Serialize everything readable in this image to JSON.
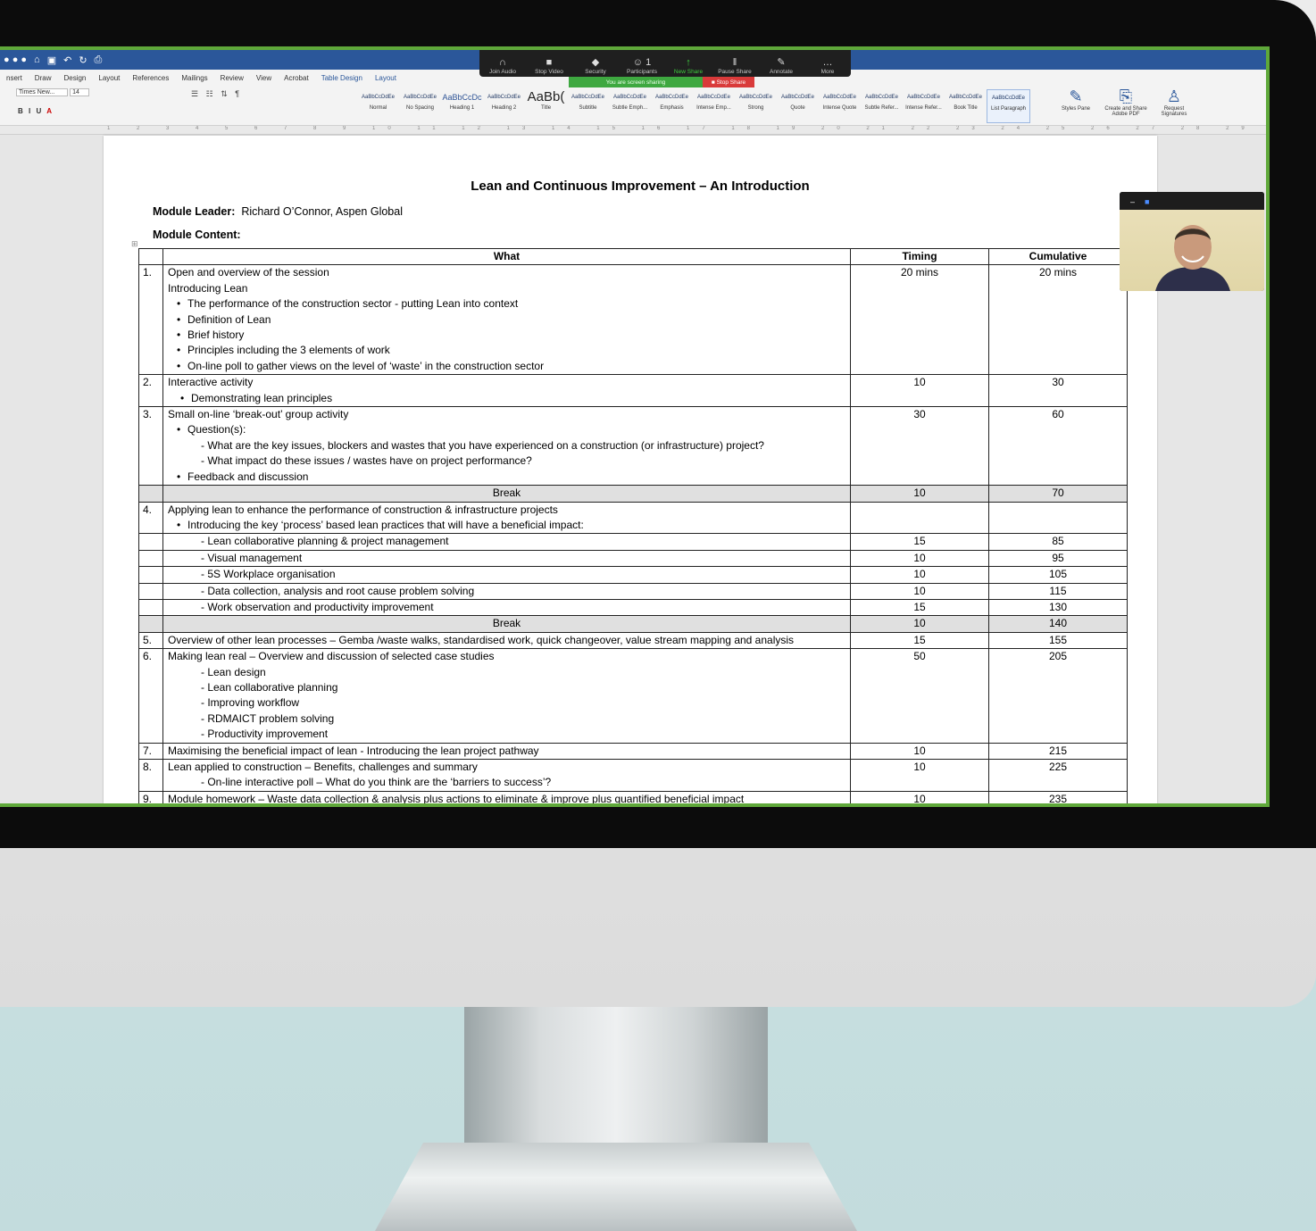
{
  "word": {
    "ribbon_tabs": [
      "nsert",
      "Draw",
      "Design",
      "Layout",
      "References",
      "Mailings",
      "Review",
      "View",
      "Acrobat",
      "Table Design",
      "Layout"
    ],
    "font_name": "Times New...",
    "font_size": "14",
    "styles": [
      {
        "sample": "AaBbCcDdEe",
        "label": "Normal"
      },
      {
        "sample": "AaBbCcDdEe",
        "label": "No Spacing"
      },
      {
        "sample": "AaBbCcDc",
        "label": "Heading 1"
      },
      {
        "sample": "AaBbCcDdEe",
        "label": "Heading 2"
      },
      {
        "sample": "AaBb(",
        "label": "Title"
      },
      {
        "sample": "AaBbCcDdEe",
        "label": "Subtitle"
      },
      {
        "sample": "AaBbCcDdEe",
        "label": "Subtle Emph..."
      },
      {
        "sample": "AaBbCcDdEe",
        "label": "Emphasis"
      },
      {
        "sample": "AaBbCcDdEe",
        "label": "Intense Emp..."
      },
      {
        "sample": "AaBbCcDdEe",
        "label": "Strong"
      },
      {
        "sample": "AaBbCcDdEe",
        "label": "Quote"
      },
      {
        "sample": "AaBbCcDdEe",
        "label": "Intense Quote"
      },
      {
        "sample": "AaBbCcDdEe",
        "label": "Subtle Refer..."
      },
      {
        "sample": "AaBbCcDdEe",
        "label": "Intense Refer..."
      },
      {
        "sample": "AaBbCcDdEe",
        "label": "Book Title"
      },
      {
        "sample": "AaBbCcDdEe",
        "label": "List Paragraph"
      }
    ],
    "styles_pane": "Styles Pane",
    "create_share": "Create and Share Adobe PDF",
    "request_sig": "Request Signatures"
  },
  "zoom": {
    "items": [
      {
        "icon": "headphones-icon",
        "glyph": "∩",
        "label": "Join Audio"
      },
      {
        "icon": "video-icon",
        "glyph": "■",
        "label": "Stop Video"
      },
      {
        "icon": "shield-icon",
        "glyph": "◆",
        "label": "Security"
      },
      {
        "icon": "participants-icon",
        "glyph": "☺ 1",
        "label": "Participants"
      },
      {
        "icon": "share-icon",
        "glyph": "↑",
        "label": "New Share"
      },
      {
        "icon": "pause-icon",
        "glyph": "‖",
        "label": "Pause Share"
      },
      {
        "icon": "pencil-icon",
        "glyph": "✎",
        "label": "Annotate"
      },
      {
        "icon": "more-icon",
        "glyph": "…",
        "label": "More"
      }
    ],
    "sharing_text": "You are screen sharing",
    "stop_share": "Stop Share"
  },
  "document": {
    "title": "Lean and Continuous Improvement – An Introduction",
    "leader_label": "Module Leader:",
    "leader_value": "Richard O’Connor, Aspen Global",
    "content_label": "Module Content:",
    "headers": {
      "what": "What",
      "timing": "Timing",
      "cumulative": "Cumulative"
    },
    "rows": [
      {
        "num": "1.",
        "timing": "20 mins",
        "cumulative": "20 mins",
        "lines": [
          {
            "t": "Open and overview of the session",
            "k": "plain"
          },
          {
            "t": "Introducing Lean",
            "k": "plain"
          },
          {
            "t": "The performance of the construction sector - putting Lean into context",
            "k": "bul"
          },
          {
            "t": "Definition of Lean",
            "k": "bul"
          },
          {
            "t": "Brief history",
            "k": "bul"
          },
          {
            "t": "Principles including the 3 elements of work",
            "k": "bul"
          },
          {
            "t": "On-line poll to gather views on the level of ‘waste’ in the construction sector",
            "k": "bul"
          }
        ]
      },
      {
        "num": "2.",
        "timing": "10",
        "cumulative": "30",
        "lines": [
          {
            "t": "Interactive activity",
            "k": "plain"
          },
          {
            "t": "Demonstrating lean principles",
            "k": "bul2"
          }
        ]
      },
      {
        "num": "3.",
        "timing": "30",
        "cumulative": "60",
        "lines": [
          {
            "t": "Small on-line ‘break-out’ group activity",
            "k": "plain"
          },
          {
            "t": "Question(s):",
            "k": "bul"
          },
          {
            "t": "- What are the key issues, blockers and wastes that you have experienced on a construction (or infrastructure) project?",
            "k": "dash"
          },
          {
            "t": "- What impact do these issues / wastes have on project performance?",
            "k": "dash"
          },
          {
            "t": "Feedback and discussion",
            "k": "bul"
          }
        ]
      },
      {
        "break": true,
        "label": "Break",
        "timing": "10",
        "cumulative": "70"
      },
      {
        "num": "4.",
        "timing": "",
        "cumulative": "",
        "lines": [
          {
            "t": "Applying lean to enhance the performance of construction & infrastructure projects",
            "k": "plain"
          },
          {
            "t": "Introducing the key ‘process’ based lean practices that will have a beneficial impact:",
            "k": "bul"
          }
        ]
      },
      {
        "num": "",
        "timing": "15",
        "cumulative": "85",
        "lines": [
          {
            "t": "- Lean collaborative planning & project management",
            "k": "dash"
          }
        ]
      },
      {
        "num": "",
        "timing": "10",
        "cumulative": "95",
        "lines": [
          {
            "t": "- Visual management",
            "k": "dash"
          }
        ]
      },
      {
        "num": "",
        "timing": "10",
        "cumulative": "105",
        "lines": [
          {
            "t": "- 5S Workplace organisation",
            "k": "dash"
          }
        ]
      },
      {
        "num": "",
        "timing": "10",
        "cumulative": "115",
        "lines": [
          {
            "t": "- Data collection, analysis and root cause problem solving",
            "k": "dash"
          }
        ]
      },
      {
        "num": "",
        "timing": "15",
        "cumulative": "130",
        "lines": [
          {
            "t": "- Work observation and productivity improvement",
            "k": "dash"
          }
        ]
      },
      {
        "break": true,
        "label": "Break",
        "timing": "10",
        "cumulative": "140"
      },
      {
        "num": "5.",
        "timing": "15",
        "cumulative": "155",
        "lines": [
          {
            "t": "Overview of other lean processes – Gemba /waste walks, standardised work, quick changeover, value stream mapping and analysis",
            "k": "plain"
          }
        ]
      },
      {
        "num": "6.",
        "timing": "50",
        "cumulative": "205",
        "lines": [
          {
            "t": "Making lean real – Overview and discussion of selected case studies",
            "k": "plain"
          },
          {
            "t": "- Lean design",
            "k": "dash"
          },
          {
            "t": "- Lean collaborative planning",
            "k": "dash"
          },
          {
            "t": "- Improving workflow",
            "k": "dash"
          },
          {
            "t": "- RDMAICT problem solving",
            "k": "dash"
          },
          {
            "t": "- Productivity improvement",
            "k": "dash"
          }
        ]
      },
      {
        "num": "7.",
        "timing": "10",
        "cumulative": "215",
        "lines": [
          {
            "t": "Maximising the beneficial impact of lean - Introducing the lean project pathway",
            "k": "plain"
          }
        ]
      },
      {
        "num": "8.",
        "timing": "10",
        "cumulative": "225",
        "lines": [
          {
            "t": "Lean applied to construction – Benefits, challenges and summary",
            "k": "plain"
          },
          {
            "t": "- On-line interactive poll – What do you think are the ‘barriers to success’?",
            "k": "dash"
          }
        ]
      },
      {
        "num": "9.",
        "timing": "10",
        "cumulative": "235",
        "lines": [
          {
            "t": "Module homework – Waste data collection & analysis plus actions to eliminate & improve plus quantified beneficial impact",
            "k": "plain"
          }
        ]
      }
    ]
  },
  "colors": {
    "word_blue": "#2b579a",
    "share_green": "#5fa83a",
    "zoom_green": "#3fce3f",
    "stop_red": "#d93a3a"
  }
}
